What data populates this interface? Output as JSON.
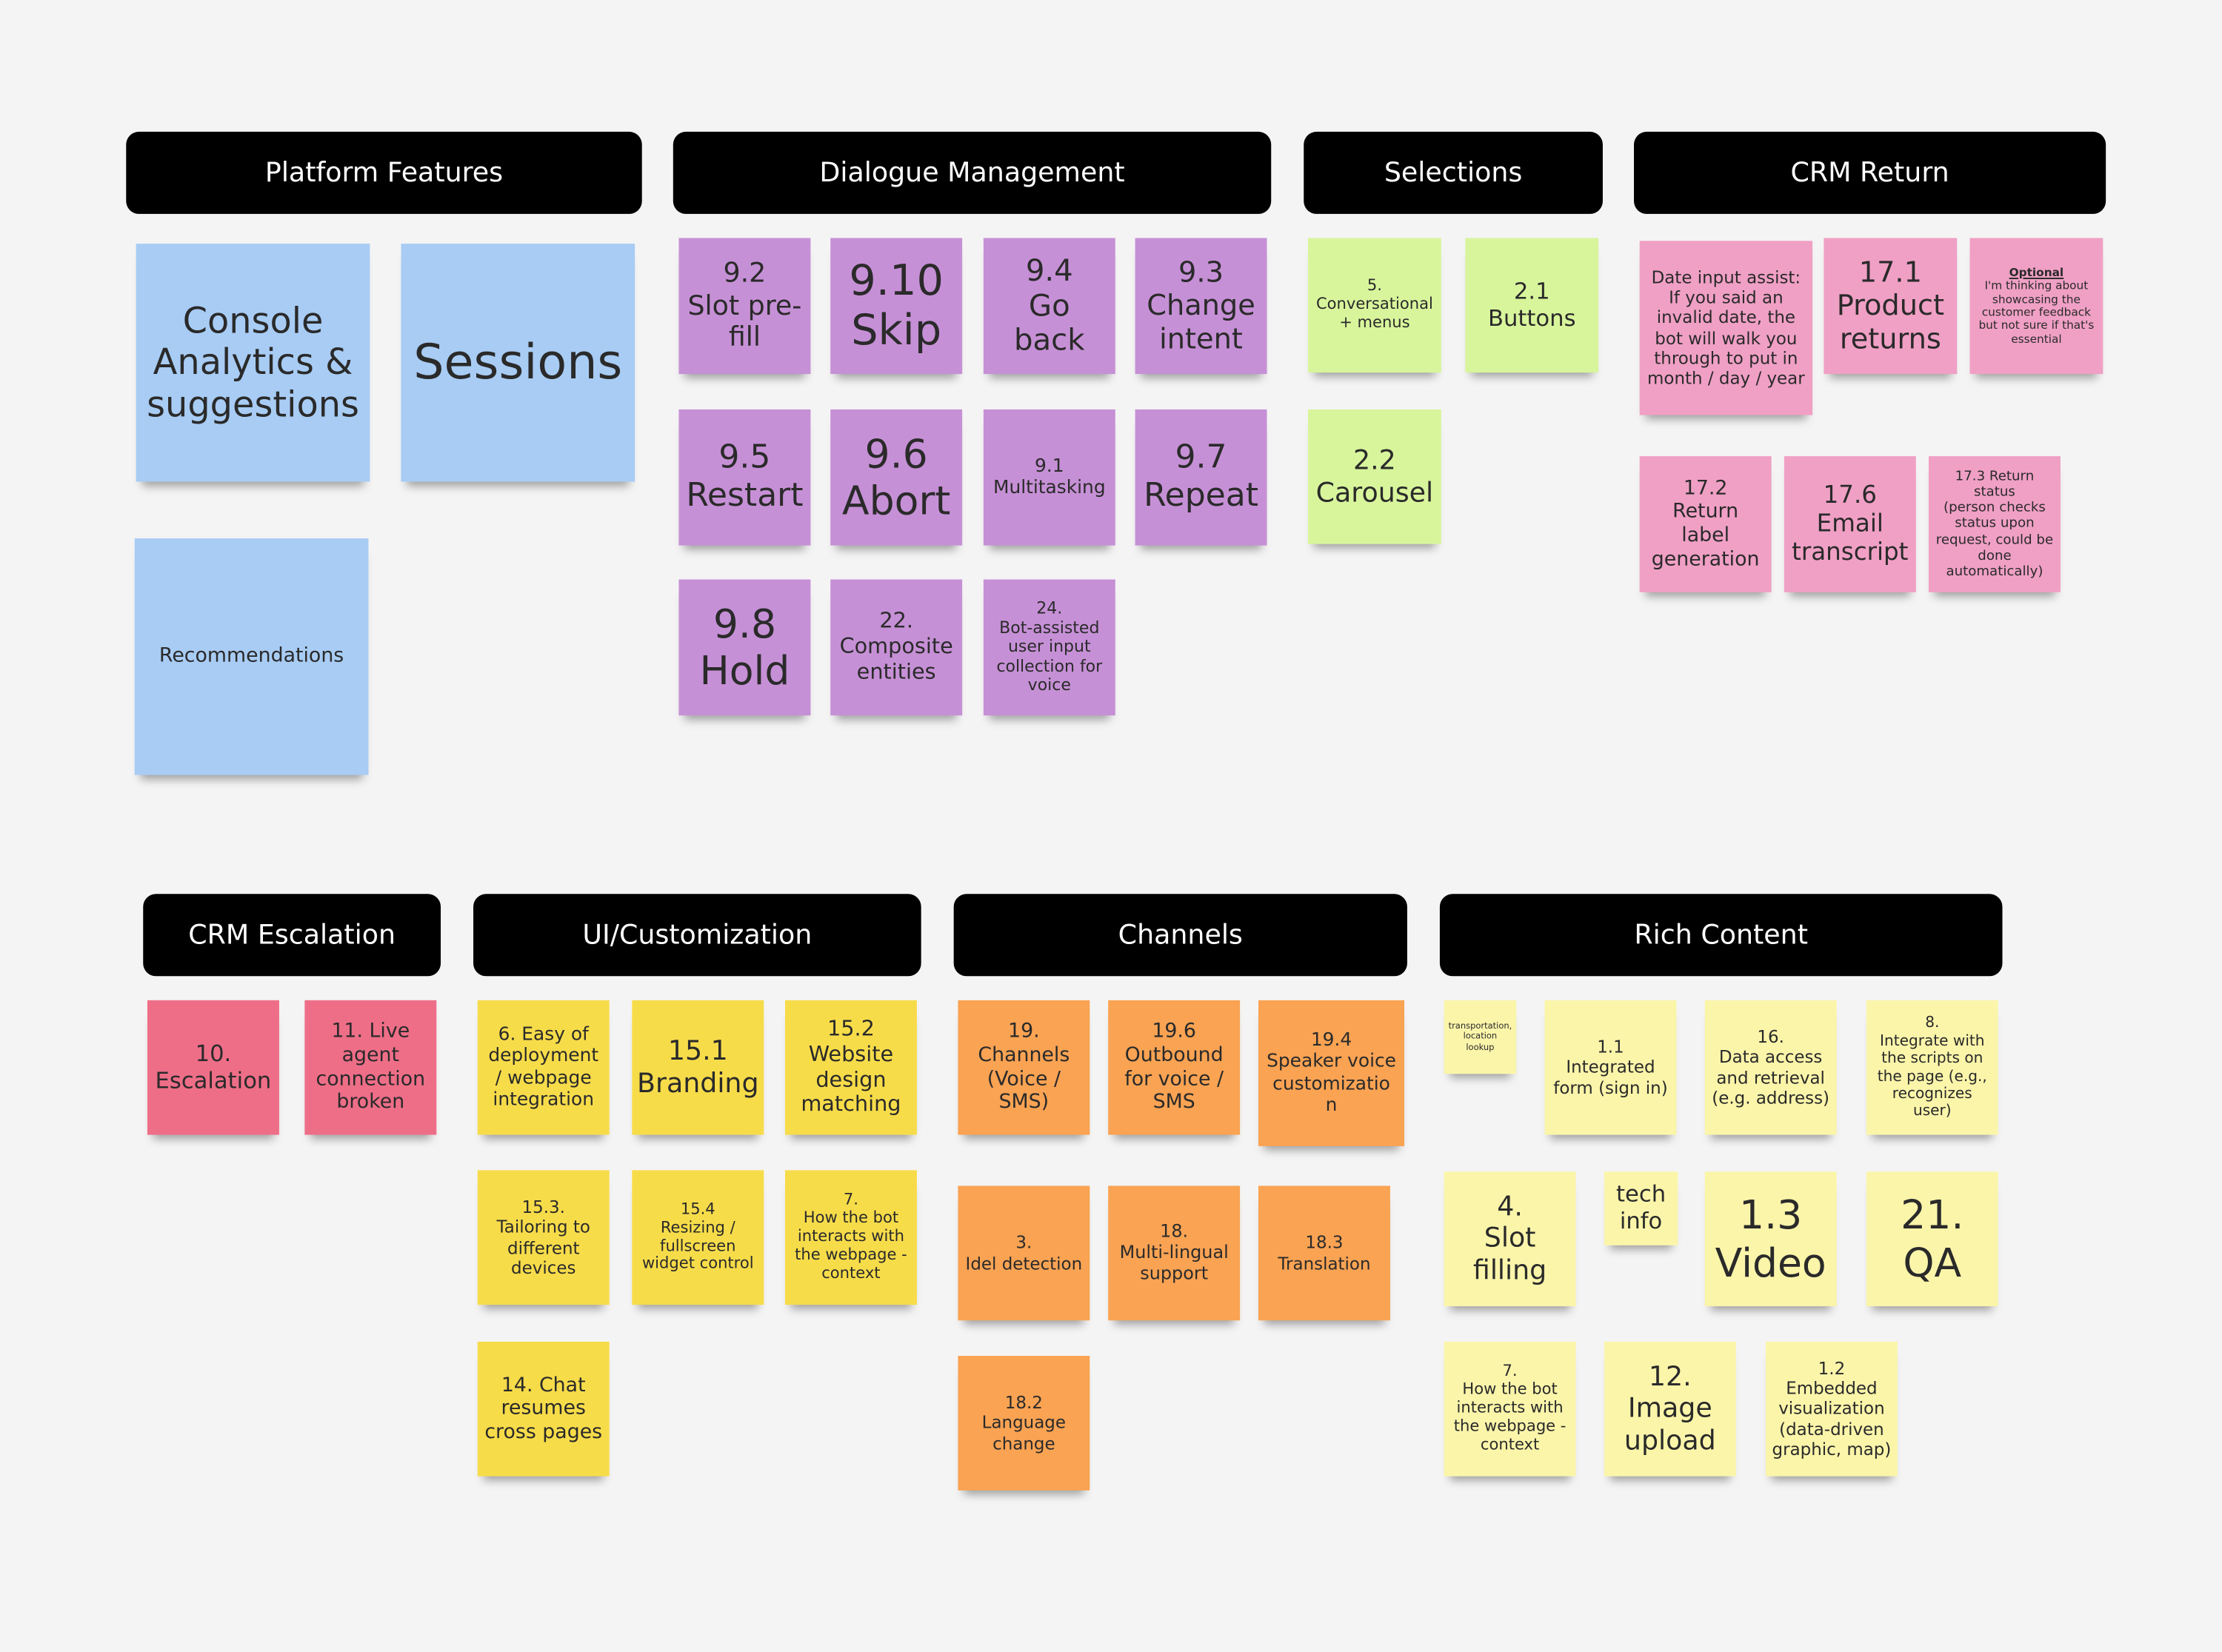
{
  "colors": {
    "background": "#f4f4f4",
    "header": "#000000",
    "blue": "#a8ccf4",
    "purple": "#c690d6",
    "green": "#d8f59c",
    "pink": "#f0a0c5",
    "red": "#ee6e88",
    "yellow": "#f7dc4a",
    "orange": "#f9a353",
    "lightyellow": "#fbf5aa"
  },
  "groups": [
    {
      "title": "Platform Features"
    },
    {
      "title": "Dialogue Management"
    },
    {
      "title": "Selections"
    },
    {
      "title": "CRM Return"
    },
    {
      "title": "CRM Escalation"
    },
    {
      "title": "UI/Customization"
    },
    {
      "title": "Channels"
    },
    {
      "title": "Rich Content"
    }
  ],
  "notes": [
    {
      "text": "Console\nAnalytics &\nsuggestions",
      "color": "blue"
    },
    {
      "text": "Sessions",
      "color": "blue"
    },
    {
      "text": "Recommendations",
      "color": "blue"
    },
    {
      "text": "9.2\nSlot pre-\nfill",
      "color": "purple"
    },
    {
      "text": "9.10\nSkip",
      "color": "purple"
    },
    {
      "text": "9.4\nGo back",
      "color": "purple"
    },
    {
      "text": "9.3\nChange\nintent",
      "color": "purple"
    },
    {
      "text": "9.5\nRestart",
      "color": "purple"
    },
    {
      "text": "9.6\nAbort",
      "color": "purple"
    },
    {
      "text": "9.1\nMultitasking",
      "color": "purple"
    },
    {
      "text": "9.7\nRepeat",
      "color": "purple"
    },
    {
      "text": "9.8\nHold",
      "color": "purple"
    },
    {
      "text": "22.\nComposite\nentities",
      "color": "purple"
    },
    {
      "text": "24.\nBot-assisted\nuser input\ncollection for\nvoice",
      "color": "purple"
    },
    {
      "text": "5.\nConversational\n+ menus",
      "color": "green"
    },
    {
      "text": "2.1\nButtons",
      "color": "green"
    },
    {
      "text": "2.2\nCarousel",
      "color": "green"
    },
    {
      "text": "Date input assist:\nIf you said an\ninvalid date, the\nbot will walk you\nthrough to put in\nmonth / day / year",
      "color": "pink"
    },
    {
      "text": "17.1\nProduct\nreturns",
      "color": "pink"
    },
    {
      "label": "Optional",
      "text": "I'm thinking about\nshowcasing the\ncustomer feedback\nbut not sure if that's\nessential",
      "color": "pink"
    },
    {
      "text": "17.2\nReturn\nlabel\ngeneration",
      "color": "pink"
    },
    {
      "text": "17.6\nEmail\ntranscript",
      "color": "pink"
    },
    {
      "text": "17.3 Return status\n(person checks\nstatus upon\nrequest, could be\ndone\nautomatically)",
      "color": "pink"
    },
    {
      "text": "10.\nEscalation",
      "color": "red"
    },
    {
      "text": "11. Live\nagent\nconnection\nbroken",
      "color": "red"
    },
    {
      "text": "6. Easy of\ndeployment\n/ webpage\nintegration",
      "color": "yellow"
    },
    {
      "text": "15.1\nBranding",
      "color": "yellow"
    },
    {
      "text": "15.2\nWebsite\ndesign\nmatching",
      "color": "yellow"
    },
    {
      "text": "15.3.\nTailoring to\ndifferent\ndevices",
      "color": "yellow"
    },
    {
      "text": "15.4\nResizing /\nfullscreen\nwidget control",
      "color": "yellow"
    },
    {
      "text": "7.\nHow the bot\ninteracts with\nthe webpage -\ncontext",
      "color": "yellow"
    },
    {
      "text": "14. Chat\nresumes\ncross pages",
      "color": "yellow"
    },
    {
      "text": "19.\nChannels\n(Voice /\nSMS)",
      "color": "orange"
    },
    {
      "text": "19.6\nOutbound\nfor voice /\nSMS",
      "color": "orange"
    },
    {
      "text": "19.4\nSpeaker voice\ncustomizatio\nn",
      "color": "orange"
    },
    {
      "text": "3.\nIdel detection",
      "color": "orange"
    },
    {
      "text": "18.\nMulti-lingual\nsupport",
      "color": "orange"
    },
    {
      "text": "18.3\nTranslation",
      "color": "orange"
    },
    {
      "text": "18.2\nLanguage\nchange",
      "color": "orange"
    },
    {
      "text": "transportation,\nlocation\nlookup",
      "color": "lightyellow"
    },
    {
      "text": "1.1\nIntegrated\nform (sign in)",
      "color": "lightyellow"
    },
    {
      "text": "16.\nData access\nand retrieval\n(e.g. address)",
      "color": "lightyellow"
    },
    {
      "text": "8.\nIntegrate with\nthe scripts on\nthe page (e.g.,\nrecognizes user)",
      "color": "lightyellow"
    },
    {
      "text": "4.\nSlot\nfilling",
      "color": "lightyellow"
    },
    {
      "text": "tech\ninfo",
      "color": "lightyellow"
    },
    {
      "text": "1.3\nVideo",
      "color": "lightyellow"
    },
    {
      "text": "21.\nQA",
      "color": "lightyellow"
    },
    {
      "text": "7.\nHow the bot\ninteracts with\nthe webpage -\ncontext",
      "color": "lightyellow"
    },
    {
      "text": "12.\nImage\nupload",
      "color": "lightyellow"
    },
    {
      "text": "1.2\nEmbedded\nvisualization\n(data-driven\ngraphic, map)",
      "color": "lightyellow"
    }
  ]
}
